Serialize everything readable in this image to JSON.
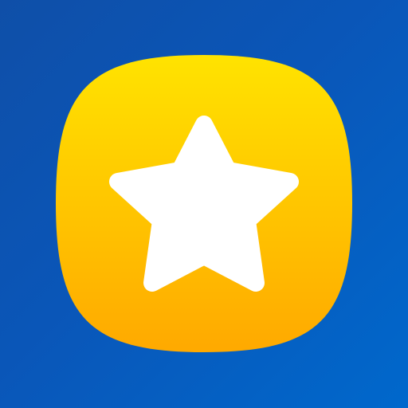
{
  "icon": {
    "name": "star-icon",
    "background_color_start": "#0f4fa8",
    "background_color_end": "#0068cc",
    "badge_color_top": "#ffe300",
    "badge_color_bottom": "#ffa900",
    "star_color": "#ffffff"
  }
}
